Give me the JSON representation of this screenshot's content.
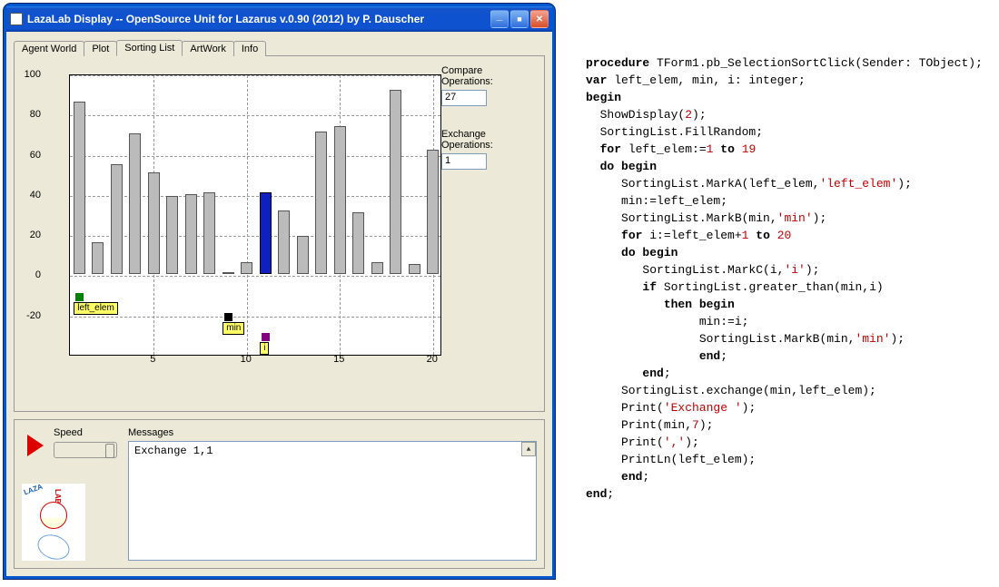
{
  "window": {
    "title": "LazaLab Display  --  OpenSource Unit for Lazarus   v.0.90 (2012) by P. Dauscher"
  },
  "tabs": [
    "Agent World",
    "Plot",
    "Sorting List",
    "ArtWork",
    "Info"
  ],
  "active_tab": "Sorting List",
  "compare_label": "Compare Operations:",
  "compare_value": "27",
  "exchange_label": "Exchange Operations:",
  "exchange_value": "1",
  "speed_label": "Speed",
  "messages_label": "Messages",
  "messages_text": "Exchange       1,1",
  "markers": {
    "left_elem": {
      "label": "left_elem",
      "x": 1,
      "y": -10,
      "color": "#008000"
    },
    "min": {
      "label": "min",
      "x": 9,
      "y": -20,
      "color": "#000000"
    },
    "i": {
      "label": "i",
      "x": 11,
      "y": -30,
      "color": "#800080"
    }
  },
  "chart_data": {
    "type": "bar",
    "categories": [
      1,
      2,
      3,
      4,
      5,
      6,
      7,
      8,
      9,
      10,
      11,
      12,
      13,
      14,
      15,
      16,
      17,
      18,
      19,
      20
    ],
    "values": [
      86,
      16,
      55,
      70,
      51,
      39,
      40,
      41,
      1,
      6,
      41,
      32,
      19,
      71,
      74,
      31,
      6,
      92,
      5,
      62
    ],
    "highlight_index": 11,
    "xlabel": "",
    "ylabel": "",
    "ylim": [
      -40,
      100
    ],
    "xticks": [
      5,
      10,
      15,
      20
    ],
    "yticks": [
      -20,
      0,
      20,
      40,
      60,
      80,
      100
    ]
  },
  "code": {
    "lines": [
      [
        "kw:procedure",
        " TForm1.pb_SelectionSortClick(Sender: TObject);"
      ],
      [
        "kw:var",
        " left_elem, min, i: integer;"
      ],
      [
        "kw:begin"
      ],
      [
        "  ShowDisplay(",
        "num:2",
        ");"
      ],
      [
        "  SortingList.FillRandom;"
      ],
      [
        "  ",
        "kw:for",
        " left_elem:=",
        "num:1",
        " ",
        "kw:to",
        " ",
        "num:19"
      ],
      [
        "  ",
        "kw:do begin"
      ],
      [
        "     SortingList.MarkA(left_elem,",
        "str:'left_elem'",
        ");"
      ],
      [
        "     min:=left_elem;"
      ],
      [
        "     SortingList.MarkB(min,",
        "str:'min'",
        ");"
      ],
      [
        "     ",
        "kw:for",
        " i:=left_elem+",
        "num:1",
        " ",
        "kw:to",
        " ",
        "num:20"
      ],
      [
        "     ",
        "kw:do begin"
      ],
      [
        "        SortingList.MarkC(i,",
        "str:'i'",
        ");"
      ],
      [
        "        ",
        "kw:if",
        " SortingList.greater_than(min,i)"
      ],
      [
        "           ",
        "kw:then begin"
      ],
      [
        "                min:=i;"
      ],
      [
        "                SortingList.MarkB(min,",
        "str:'min'",
        ");"
      ],
      [
        "                ",
        "kw:end",
        ";"
      ],
      [
        "        ",
        "kw:end",
        ";"
      ],
      [
        "     SortingList.exchange(min,left_elem);"
      ],
      [
        "     Print(",
        "str:'Exchange '",
        ");"
      ],
      [
        "     Print(min,",
        "num:7",
        ");"
      ],
      [
        "     Print(",
        "str:','",
        ");"
      ],
      [
        "     PrintLn(left_elem);"
      ],
      [
        "     ",
        "kw:end",
        ";"
      ],
      [
        "kw:end",
        ";"
      ]
    ]
  }
}
